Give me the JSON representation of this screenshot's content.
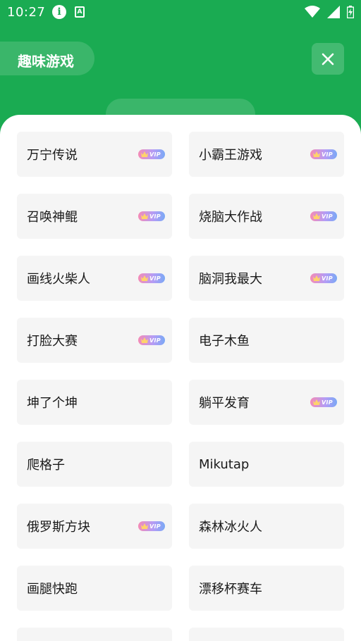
{
  "status_bar": {
    "time": "10:27",
    "icons": [
      "info-icon",
      "a-notification-icon",
      "wifi-icon",
      "signal-icon",
      "battery-icon"
    ]
  },
  "header": {
    "title": "趣味游戏",
    "close_icon": "close-icon"
  },
  "colors": {
    "header_bg": "#1aab52",
    "card_bg": "#f5f5f5",
    "vip_gradient": [
      "#f58bb5",
      "#b59cf5",
      "#7aa8f5"
    ]
  },
  "vip_badge_text": "VIP",
  "games": [
    {
      "name": "万宁传说",
      "vip": true
    },
    {
      "name": "小霸王游戏",
      "vip": true
    },
    {
      "name": "召唤神鲲",
      "vip": true
    },
    {
      "name": "烧脑大作战",
      "vip": true
    },
    {
      "name": "画线火柴人",
      "vip": true
    },
    {
      "name": "脑洞我最大",
      "vip": true
    },
    {
      "name": "打脸大赛",
      "vip": true
    },
    {
      "name": "电子木鱼",
      "vip": false
    },
    {
      "name": "坤了个坤",
      "vip": false
    },
    {
      "name": "躺平发育",
      "vip": true
    },
    {
      "name": "爬格子",
      "vip": false
    },
    {
      "name": "Mikutap",
      "vip": false
    },
    {
      "name": "俄罗斯方块",
      "vip": true
    },
    {
      "name": "森林冰火人",
      "vip": false
    },
    {
      "name": "画腿快跑",
      "vip": false
    },
    {
      "name": "漂移杯赛车",
      "vip": false
    },
    {
      "name": "",
      "vip": false
    },
    {
      "name": "",
      "vip": false
    }
  ]
}
